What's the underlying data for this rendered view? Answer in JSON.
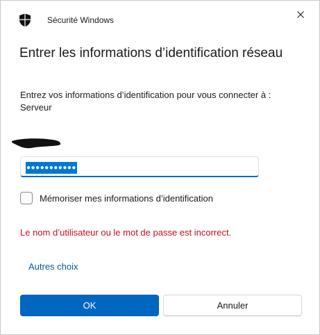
{
  "window": {
    "app_title": "Sécurité Windows",
    "app_icon": "shield-icon",
    "close_icon": "close-icon"
  },
  "heading": "Entrer les informations d’identification réseau",
  "description": {
    "line1": "Entrez vos informations d’identification pour vous connecter à :",
    "line2": "Serveur"
  },
  "password": {
    "value": "●●●●●●●●●●●"
  },
  "remember": {
    "label": "Mémoriser mes informations d’identification",
    "checked": false
  },
  "error": {
    "message": "Le nom d’utilisateur ou le mot de passe est incorrect."
  },
  "links": {
    "more_choices": "Autres choix"
  },
  "buttons": {
    "ok": "OK",
    "cancel": "Annuler"
  },
  "colors": {
    "accent": "#0067c0",
    "selection": "#0078d4",
    "error": "#c50f1f",
    "link": "#005a9e"
  }
}
